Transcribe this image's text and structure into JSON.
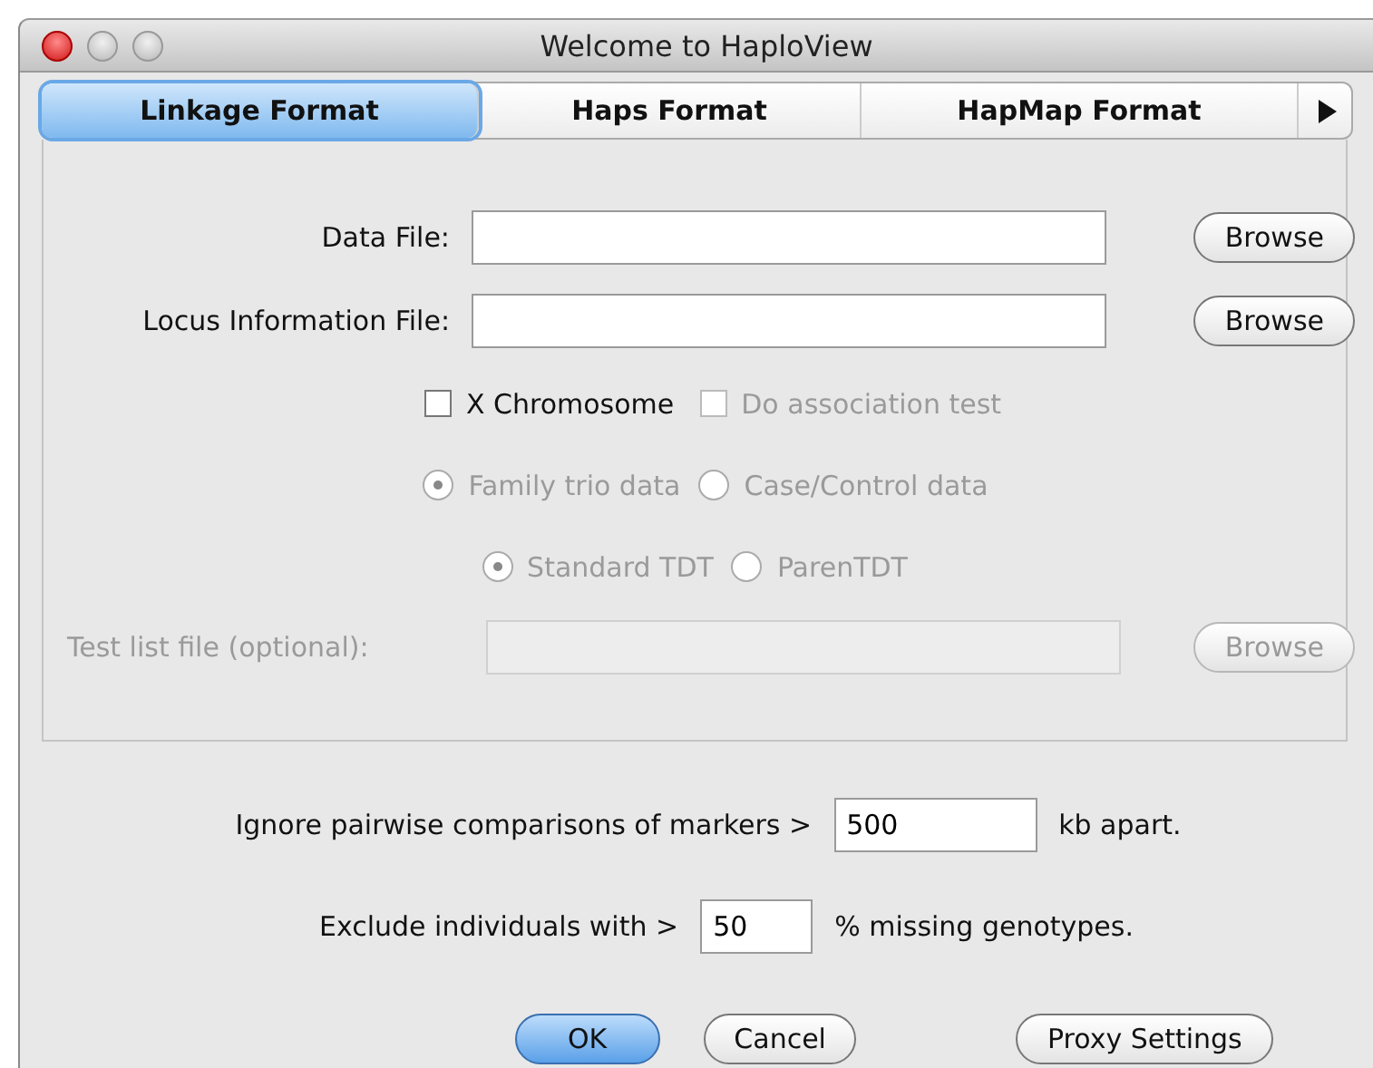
{
  "window": {
    "title": "Welcome to HaploView"
  },
  "tabs": [
    {
      "label": "Linkage Format",
      "selected": true
    },
    {
      "label": "Haps Format",
      "selected": false
    },
    {
      "label": "HapMap Format",
      "selected": false
    }
  ],
  "file_rows": [
    {
      "label": "Data File:",
      "button": "Browse",
      "disabled": false
    },
    {
      "label": "Locus Information File:",
      "button": "Browse",
      "disabled": false
    }
  ],
  "checkboxes": [
    {
      "label": "X Chromosome",
      "checked": false,
      "disabled": false
    },
    {
      "label": "Do association test",
      "checked": false,
      "disabled": true
    }
  ],
  "radio_groups": [
    {
      "options": [
        {
          "label": "Family trio data",
          "selected": true,
          "disabled": true
        },
        {
          "label": "Case/Control data",
          "selected": false,
          "disabled": true
        }
      ]
    },
    {
      "options": [
        {
          "label": "Standard TDT",
          "selected": true,
          "disabled": true
        },
        {
          "label": "ParenTDT",
          "selected": false,
          "disabled": true
        }
      ]
    }
  ],
  "test_list_row": {
    "label": "Test list file (optional):",
    "button": "Browse",
    "disabled": true
  },
  "ignore": {
    "before": "Ignore pairwise comparisons of markers >",
    "value": "500",
    "after": "kb apart."
  },
  "exclude": {
    "before": "Exclude individuals with >",
    "value": "50",
    "after": "% missing genotypes."
  },
  "buttons": [
    {
      "label": "OK",
      "default": true
    },
    {
      "label": "Cancel",
      "default": false
    },
    {
      "label": "Proxy Settings",
      "default": false
    }
  ]
}
